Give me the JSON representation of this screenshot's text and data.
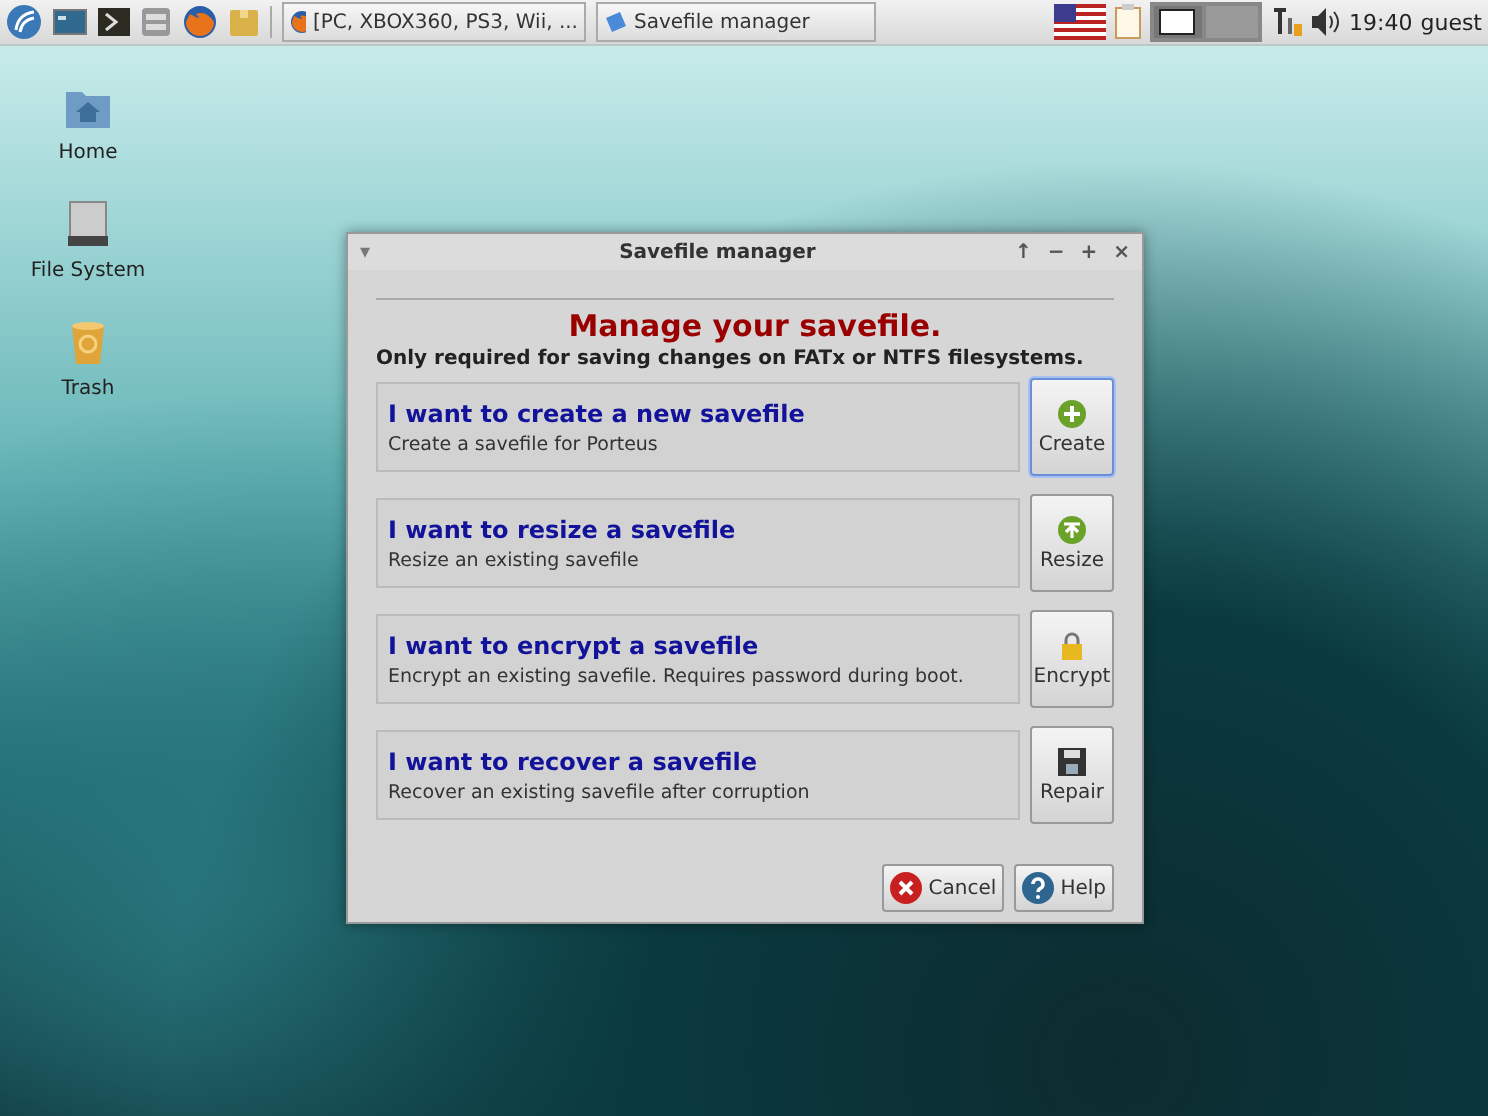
{
  "taskbar": {
    "launchers": [
      {
        "kind": "start"
      },
      {
        "kind": "desktop"
      },
      {
        "kind": "terminal"
      },
      {
        "kind": "files"
      },
      {
        "kind": "browser"
      },
      {
        "kind": "package"
      }
    ],
    "tasks": [
      {
        "label": "[PC, XBOX360, PS3, Wii, ...",
        "kind": "browser"
      },
      {
        "label": "Savefile manager",
        "kind": "app"
      }
    ],
    "tray": {
      "clock": "19:40",
      "user": "guest"
    }
  },
  "desktop_icons": [
    {
      "label": "Home",
      "kind": "home"
    },
    {
      "label": "File System",
      "kind": "drive"
    },
    {
      "label": "Trash",
      "kind": "trash"
    }
  ],
  "dialog": {
    "title": "Savefile manager",
    "menu_glyph": "▾",
    "controls": [
      "↑",
      "−",
      "+",
      "×"
    ],
    "heading": "Manage your savefile.",
    "subheading": "Only required for saving changes on FATx or NTFS filesystems.",
    "options": [
      {
        "title": "I want to create a new savefile",
        "description": "Create a savefile for Porteus",
        "button": "Create",
        "kind": "create",
        "focused": true
      },
      {
        "title": "I want to resize a savefile",
        "description": "Resize an existing savefile",
        "button": "Resize",
        "kind": "resize",
        "focused": false
      },
      {
        "title": "I want to encrypt a savefile",
        "description": "Encrypt an existing savefile. Requires password during boot.",
        "button": "Encrypt",
        "kind": "encrypt",
        "focused": false
      },
      {
        "title": "I want to recover a savefile",
        "description": "Recover an existing savefile after corruption",
        "button": "Repair",
        "kind": "repair",
        "focused": false
      }
    ],
    "buttons": [
      {
        "label": "Cancel",
        "kind": "cancel"
      },
      {
        "label": "Help",
        "kind": "help"
      }
    ]
  }
}
